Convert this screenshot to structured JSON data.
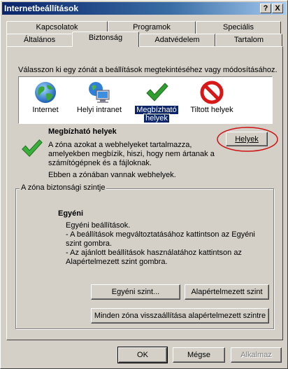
{
  "window": {
    "title": "Internetbeállítások",
    "help_button": "?",
    "close_button": "X"
  },
  "tabs": {
    "back_row": [
      "Kapcsolatok",
      "Programok",
      "Speciális"
    ],
    "front_row": [
      "Általános",
      "Biztonság",
      "Adatvédelem",
      "Tartalom"
    ],
    "active": "Biztonság"
  },
  "security": {
    "instruction": "Válasszon ki egy zónát a beállítások megtekintéséhez vagy módosításához.",
    "zones": [
      {
        "label_line1": "Internet",
        "label_line2": "",
        "icon": "globe-icon"
      },
      {
        "label_line1": "Helyi intranet",
        "label_line2": "",
        "icon": "intranet-icon"
      },
      {
        "label_line1": "Megbízható",
        "label_line2": "helyek",
        "icon": "checkmark-icon",
        "selected": true
      },
      {
        "label_line1": "Tiltott helyek",
        "label_line2": "",
        "icon": "restricted-icon"
      }
    ],
    "zone_title": "Megbízható helyek",
    "zone_desc_line1": "A zóna azokat a webhelyeket tartalmazza,",
    "zone_desc_line2": "amelyekben megbízik, hiszi, hogy nem ártanak a",
    "zone_desc_line3": "számítógépnek és a fájloknak.",
    "zone_status": "Ebben a zónában vannak webhelyek.",
    "sites_button": "Helyek",
    "group_title": "A zóna biztonsági szintje",
    "level_title": "Egyéni",
    "level_line1": "Egyéni beállítások.",
    "level_line2": "- A beállítások megváltoztatásához kattintson az Egyéni",
    "level_line3": "szint gombra.",
    "level_line4": "- Az ajánlott beállítások használatához kattintson az",
    "level_line5": "Alapértelmezett szint gombra.",
    "custom_level_button": "Egyéni szint...",
    "default_level_button": "Alapértelmezett szint",
    "reset_all_button": "Minden zóna visszaállítása alapértelmezett szintre"
  },
  "footer": {
    "ok": "OK",
    "cancel": "Mégse",
    "apply": "Alkalmaz"
  },
  "colors": {
    "title_bar": "#0a246a",
    "highlight_ellipse": "#d01010",
    "check_green": "#2f9e2f"
  }
}
